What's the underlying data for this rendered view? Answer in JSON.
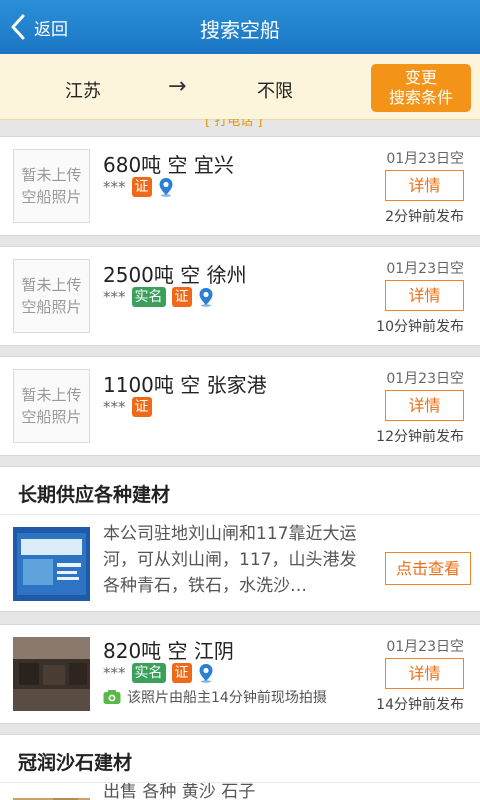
{
  "header": {
    "back_label": "返回",
    "title": "搜索空船"
  },
  "filter": {
    "from": "江苏",
    "arrow": "→",
    "to": "不限",
    "change_line1": "变更",
    "change_line2": "搜索条件"
  },
  "ships": [
    {
      "photo_line1": "暂未上传",
      "photo_line2": "空船照片",
      "title": "680吨 空 宜兴",
      "stars": "***",
      "verified_label": "证",
      "date": "01月23日空",
      "detail_label": "详情",
      "ago": "2分钟前发布"
    },
    {
      "photo_line1": "暂未上传",
      "photo_line2": "空船照片",
      "title": "2500吨 空 徐州",
      "stars": "***",
      "realname_label": "实名",
      "verified_label": "证",
      "date": "01月23日空",
      "detail_label": "详情",
      "ago": "10分钟前发布"
    },
    {
      "photo_line1": "暂未上传",
      "photo_line2": "空船照片",
      "title": "1100吨 空 张家港",
      "stars": "***",
      "verified_label": "证",
      "date": "01月23日空",
      "detail_label": "详情",
      "ago": "12分钟前发布"
    },
    {
      "title": "820吨 空 江阴",
      "stars": "***",
      "realname_label": "实名",
      "verified_label": "证",
      "date": "01月23日空",
      "detail_label": "详情",
      "note": "该照片由船主14分钟前现场拍摄",
      "ago": "14分钟前发布"
    }
  ],
  "ads": [
    {
      "heading": "长期供应各种建材",
      "text": "本公司驻地刘山闸和117靠近大运河，可从刘山闸，117，山头港发各种青石，铁石，水洗沙…",
      "button_label": "点击查看"
    },
    {
      "heading": "冠润沙石建材",
      "text": "出售 各种 黄沙 石子"
    }
  ],
  "colors": {
    "header": "#1a76c4",
    "accent_orange": "#f39418",
    "tag_verified": "#ee6a1a",
    "tag_realname": "#3aa05a"
  }
}
